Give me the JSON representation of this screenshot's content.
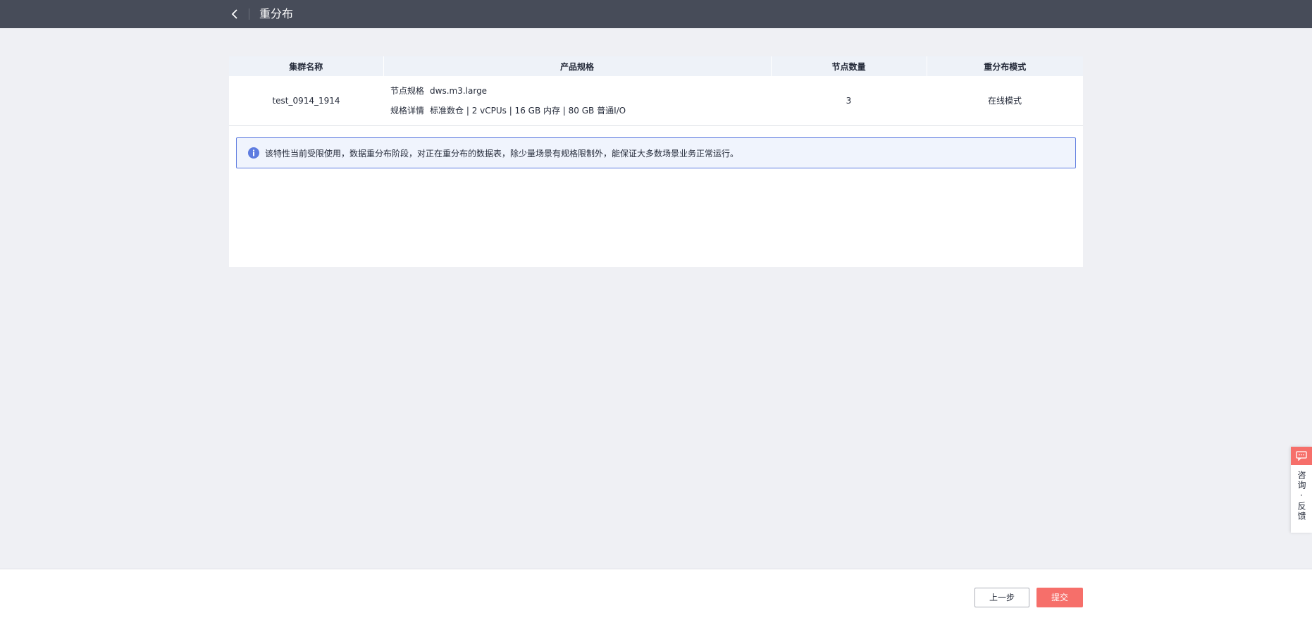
{
  "header": {
    "title": "重分布",
    "back_icon": "chevron-left-icon"
  },
  "table": {
    "columns": [
      "集群名称",
      "产品规格",
      "节点数量",
      "重分布模式"
    ],
    "row": {
      "cluster_name": "test_0914_1914",
      "spec_label": "节点规格",
      "spec_value": "dws.m3.large",
      "detail_label": "规格详情",
      "detail_value": "标准数仓 | 2 vCPUs | 16 GB 内存 | 80 GB 普通I/O",
      "node_count": "3",
      "redistribution_mode": "在线模式"
    }
  },
  "notice": {
    "icon": "info-icon",
    "text": "该特性当前受限使用，数据重分布阶段，对正在重分布的数据表，除少量场景有规格限制外，能保证大多数场景业务正常运行。"
  },
  "footer": {
    "prev_label": "上一步",
    "submit_label": "提交"
  },
  "feedback": {
    "label": "咨询·反馈",
    "icon": "chat-icon"
  },
  "colors": {
    "topbar": "#474c59",
    "accent": "#f66f6a",
    "info": "#5e7ce0"
  }
}
